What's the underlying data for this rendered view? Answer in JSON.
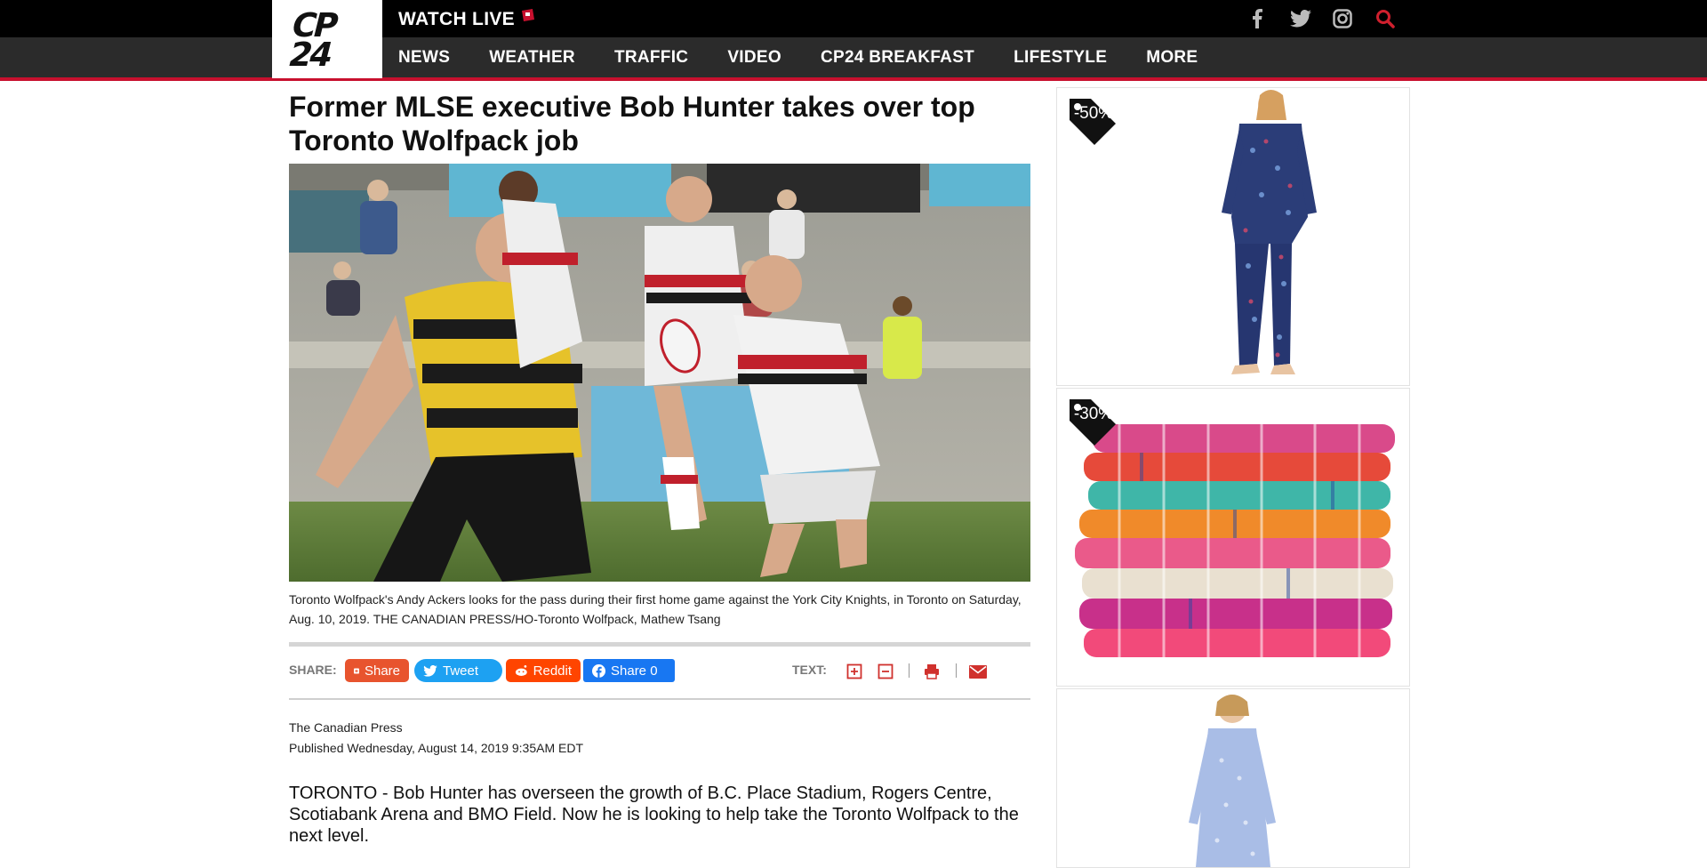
{
  "header": {
    "logo_text": "CP24",
    "watch_live": "WATCH LIVE",
    "social": [
      "facebook-icon",
      "twitter-icon",
      "instagram-icon",
      "search-icon"
    ]
  },
  "nav": {
    "items": [
      "NEWS",
      "WEATHER",
      "TRAFFIC",
      "VIDEO",
      "CP24 BREAKFAST",
      "LIFESTYLE",
      "MORE"
    ]
  },
  "article": {
    "headline": "Former MLSE executive Bob Hunter takes over top Toronto Wolfpack job",
    "caption": "Toronto Wolfpack's Andy Ackers looks for the pass during their first home game against the York City Knights, in Toronto on Saturday, Aug. 10, 2019. THE CANADIAN PRESS/HO-Toronto Wolfpack, Mathew Tsang",
    "share_label": "SHARE:",
    "share_buttons": {
      "share": "Share",
      "tweet": "Tweet",
      "reddit": "Reddit",
      "fb_share": "Share 0"
    },
    "text_label": "TEXT:",
    "source": "The Canadian Press",
    "published": "Published Wednesday, August 14, 2019 9:35AM EDT",
    "body": "TORONTO - Bob Hunter has overseen the growth of B.C. Place Stadium, Rogers Centre, Scotiabank Arena and BMO Field. Now he is looking to help take the Toronto Wolfpack to the next level."
  },
  "ads": [
    {
      "discount": "-50%",
      "product": "pajama-set"
    },
    {
      "discount": "-30%",
      "product": "woven-blankets"
    },
    {
      "discount": "",
      "product": "nightgown"
    }
  ],
  "colors": {
    "brand_red": "#c8102e",
    "share_orange": "#e8542e",
    "twitter_blue": "#1da1f2",
    "reddit_orange": "#ff4500",
    "facebook_blue": "#1877f2",
    "tool_red": "#d0312d"
  }
}
